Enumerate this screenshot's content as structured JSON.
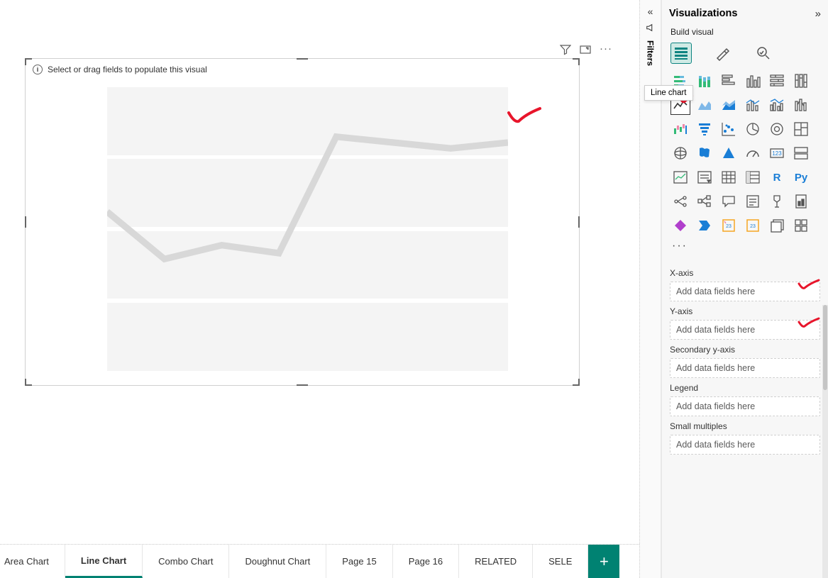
{
  "canvas": {
    "visual_hint": "Select or drag fields to populate this visual",
    "toolbar": {
      "more": "···"
    }
  },
  "page_tabs": {
    "items": [
      {
        "label": "Area Chart",
        "active": false
      },
      {
        "label": "Line Chart",
        "active": true
      },
      {
        "label": "Combo Chart",
        "active": false
      },
      {
        "label": "Doughnut Chart",
        "active": false
      },
      {
        "label": "Page 15",
        "active": false
      },
      {
        "label": "Page 16",
        "active": false
      },
      {
        "label": "RELATED",
        "active": false
      },
      {
        "label": "SELE",
        "active": false
      }
    ],
    "add": "+"
  },
  "filters_strip": {
    "label": "Filters"
  },
  "viz_panel": {
    "title": "Visualizations",
    "subtitle": "Build visual",
    "tooltip": "Line chart",
    "py_label": "Py",
    "r_label": "R",
    "more": "···",
    "wells": [
      {
        "label": "X-axis",
        "placeholder": "Add data fields here",
        "check": true
      },
      {
        "label": "Y-axis",
        "placeholder": "Add data fields here",
        "check": true
      },
      {
        "label": "Secondary y-axis",
        "placeholder": "Add data fields here",
        "check": false
      },
      {
        "label": "Legend",
        "placeholder": "Add data fields here",
        "check": false
      },
      {
        "label": "Small multiples",
        "placeholder": "Add data fields here",
        "check": false
      }
    ]
  },
  "chart_data": {
    "type": "line",
    "title": "",
    "xlabel": "",
    "ylabel": "",
    "x": [
      0,
      1,
      2,
      3,
      4,
      5,
      6,
      7
    ],
    "values": [
      55,
      38,
      43,
      40,
      82,
      80,
      78,
      80
    ],
    "ylim": [
      0,
      100
    ]
  }
}
